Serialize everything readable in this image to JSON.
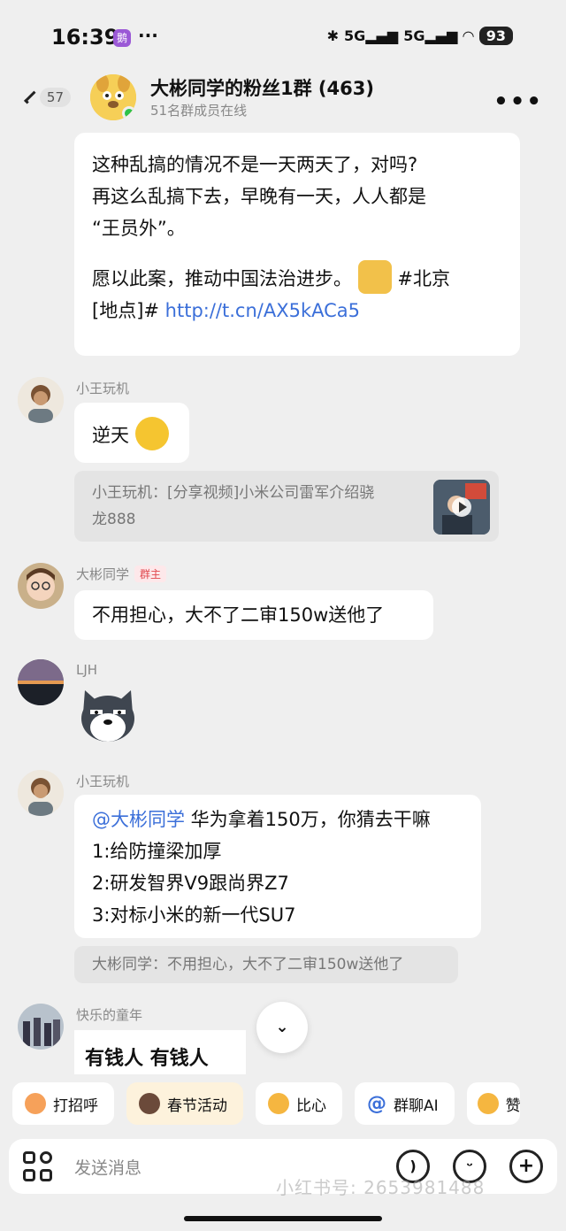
{
  "status": {
    "time": "16:39",
    "battery": "93",
    "signal1": "5G",
    "signal2": "5G"
  },
  "header": {
    "back_count": "57",
    "title": "大彬同学的粉丝1群 (463)",
    "subtitle": "51名群成员在线"
  },
  "messages": {
    "post": {
      "line1": "这种乱搞的情况不是一天两天了，对吗?",
      "line2": "再这么乱搞下去，早晚有一天，人人都是",
      "line3": "“王员外”。",
      "line4a": "愿以此案，推动中国法治进步。",
      "line4b": "#北京",
      "line5a": "[地点]#",
      "link": "http://t.cn/AX5kACa5"
    },
    "m1": {
      "sender": "小王玩机",
      "text": "逆天",
      "quote_line1": "小王玩机：[分享视频]小米公司雷军介绍骁",
      "quote_line2": "龙888"
    },
    "m2": {
      "sender": "大彬同学",
      "role": "群主",
      "text": "不用担心，大不了二审150w送他了"
    },
    "m3": {
      "sender": "LJH"
    },
    "m4": {
      "sender": "小王玩机",
      "mention": "@大彬同学",
      "line1": " 华为拿着150万，你猜去干嘛",
      "line2": "1:给防撞梁加厚",
      "line3": "2:研发智界V9跟尚界Z7",
      "line4": "3:对标小米的新一代SU7",
      "quote": "大彬同学：不用担心，大不了二审150w送他了"
    },
    "m5": {
      "sender": "快乐的童年",
      "sticker_text": "有钱人 有钱人"
    }
  },
  "quick_actions": [
    "打招呼",
    "春节活动",
    "比心",
    "群聊AI",
    "赞"
  ],
  "input": {
    "placeholder": "发送消息"
  },
  "watermark": "小红书号: 2653981488",
  "icons": {
    "back": "chevron-left-icon",
    "more": "more-dots-icon",
    "grid": "apps-grid-icon",
    "voice": "voice-icon",
    "emoji": "emoji-icon",
    "plus": "plus-icon",
    "scroll": "chevron-double-down-icon"
  }
}
